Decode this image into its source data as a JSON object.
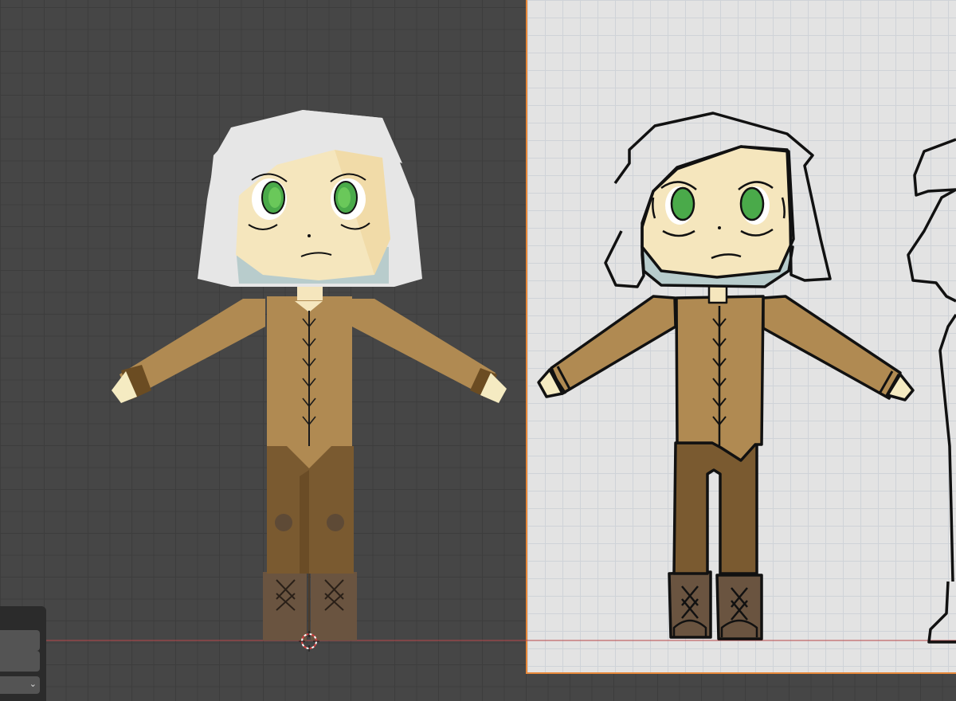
{
  "viewport": {
    "background": "#464646",
    "reference_sheet_background": "#e3e3e3",
    "reference_border": "#e8893a",
    "ground_line_color": "#b8474a"
  },
  "character_palette": {
    "hair": "#e6e6e6",
    "skin": "#f5e6bd",
    "shadow_skin": "#f0d8a2",
    "neck_back": "#b8cccc",
    "eyes": "#4aaa4a",
    "jacket": "#b08a52",
    "pants": "#7a5a30",
    "boots": "#6a5440",
    "cuffs": "#6b4c22",
    "outline": "#111111"
  },
  "icons": {
    "cursor": "3d-cursor-icon",
    "panel_dropdown": "chevron-down-icon"
  },
  "redo_panel": {
    "field_1_value": "",
    "field_2_value": "",
    "select_value": ""
  }
}
